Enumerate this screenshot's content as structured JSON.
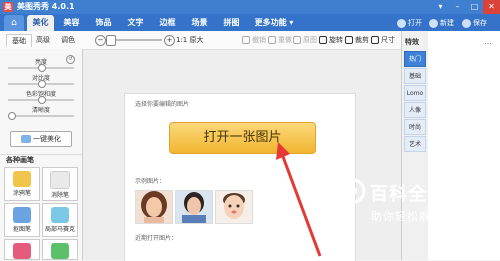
{
  "titlebar": {
    "app_icon_glyph": "美",
    "title": "美图秀秀 4.0.1",
    "controls": [
      "▾",
      "–",
      "□",
      "✕"
    ]
  },
  "tabs": [
    {
      "label": "美化",
      "active": true
    },
    {
      "label": "美容"
    },
    {
      "label": "饰品"
    },
    {
      "label": "文字"
    },
    {
      "label": "边框"
    },
    {
      "label": "场景"
    },
    {
      "label": "拼图"
    },
    {
      "label": "更多功能"
    }
  ],
  "top_actions": {
    "open": "打开",
    "new": "新建",
    "save": "保存"
  },
  "left_tabs": [
    "基础",
    "高级",
    "调色"
  ],
  "toolbar": {
    "zoom_minus": "−",
    "zoom_plus": "+",
    "original": "1:1 原大",
    "undo": "撤销",
    "redo": "重做",
    "compare": "原图",
    "rotate": "旋转",
    "crop": "裁剪",
    "size": "尺寸"
  },
  "adjustments": [
    {
      "label": "亮度",
      "level": 0.5
    },
    {
      "label": "对比度",
      "level": 0.5
    },
    {
      "label": "色彩饱和度",
      "level": 0.5
    },
    {
      "label": "清晰度",
      "level": 0.0
    }
  ],
  "onekey_label": "一键美化",
  "brushes": {
    "header": "各种画笔",
    "items": [
      {
        "label": "涂鸦笔",
        "color": "#f0c64a",
        "icon": "pen-icon"
      },
      {
        "label": "消除笔",
        "color": "#e9e9e9",
        "icon": "eraser-icon"
      },
      {
        "label": "抠图笔",
        "color": "#6aa3e2",
        "icon": "cutout-icon"
      },
      {
        "label": "局部马赛克",
        "color": "#7ac8e6",
        "icon": "mosaic-icon"
      }
    ]
  },
  "card": {
    "title": "选择你要编辑的图片",
    "open_button": "打开一张图片",
    "samples_title": "示例图片：",
    "recent_title": "近期打开图片："
  },
  "right_panel": {
    "title": "特效",
    "categories": [
      {
        "label": "热门",
        "active": true
      },
      {
        "label": "基础"
      },
      {
        "label": "Lomo"
      },
      {
        "label": "人像"
      },
      {
        "label": "时尚"
      },
      {
        "label": "艺术"
      }
    ]
  },
  "watermark": {
    "title": "百科全说",
    "subtitle": "助你轻松解决"
  }
}
